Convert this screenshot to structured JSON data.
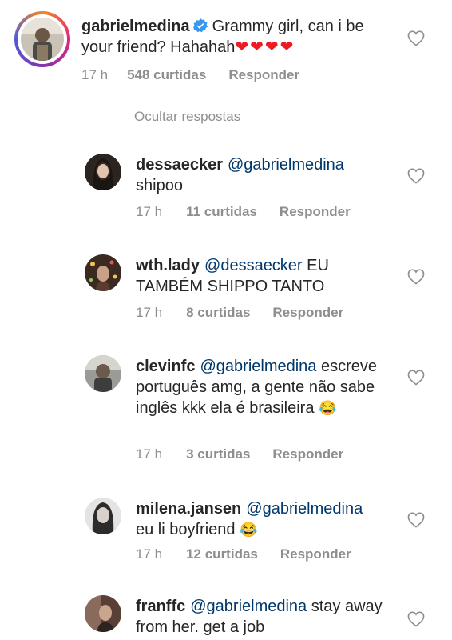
{
  "main_comment": {
    "username": "gabrielmedina",
    "verified": true,
    "text": "Grammy girl, can i be your friend? Hahahah",
    "emoji": "❤❤❤❤",
    "time": "17 h",
    "likes": "548 curtidas",
    "reply_label": "Responder"
  },
  "hide_replies_label": "Ocultar respostas",
  "replies": [
    {
      "username": "dessaecker",
      "mention": "@gabrielmedina",
      "text": "shipoo",
      "emoji": "",
      "time": "17 h",
      "likes": "11 curtidas",
      "reply_label": "Responder"
    },
    {
      "username": "wth.lady",
      "mention": "@dessaecker",
      "text": "EU TAMBÉM SHIPPO TANTO",
      "emoji": "",
      "time": "17 h",
      "likes": "8 curtidas",
      "reply_label": "Responder"
    },
    {
      "username": "clevinfc",
      "mention": "@gabrielmedina",
      "text": "escreve português amg, a gente não sabe inglês kkk ela é brasileira",
      "emoji": "😂",
      "time": "17 h",
      "likes": "3 curtidas",
      "reply_label": "Responder"
    },
    {
      "username": "milena.jansen",
      "mention": "@gabrielmedina",
      "text": "eu li boyfriend",
      "emoji": "😂",
      "time": "17 h",
      "likes": "12 curtidas",
      "reply_label": "Responder"
    },
    {
      "username": "franffc",
      "mention": "@gabrielmedina",
      "text": "stay away from her. get a job",
      "emoji": "",
      "time": "",
      "likes": "",
      "reply_label": ""
    }
  ],
  "colors": {
    "text": "#262626",
    "secondary": "#8e8e8e",
    "mention": "#00376b",
    "verified": "#3897f0",
    "heart_emoji": "#ed1c24"
  },
  "icons": {
    "like": "heart-outline-icon",
    "verified": "verified-badge-icon",
    "laugh_emoji": "face-with-tears-of-joy-emoji"
  }
}
